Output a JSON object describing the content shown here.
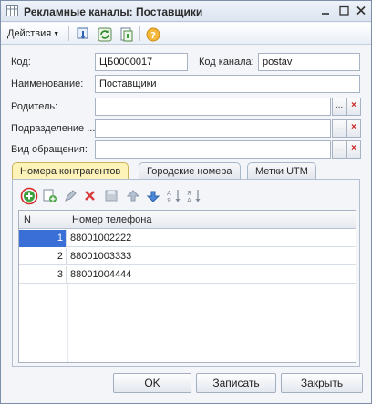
{
  "window": {
    "title": "Рекламные каналы: Поставщики"
  },
  "toolbar": {
    "actions_label": "Действия",
    "icons": [
      "save-to-list-icon",
      "refresh-icon",
      "copy-icon",
      "help-icon"
    ]
  },
  "form": {
    "code_label": "Код:",
    "code_value": "ЦБ0000017",
    "channel_code_label": "Код канала:",
    "channel_code_value": "postav",
    "name_label": "Наименование:",
    "name_value": "Поставщики",
    "parent_label": "Родитель:",
    "parent_value": "",
    "department_label": "Подразделение ...",
    "department_value": "",
    "request_type_label": "Вид обращения:",
    "request_type_value": "",
    "ellipsis": "...",
    "clear": "×"
  },
  "tabs": [
    {
      "label": "Номера контрагентов",
      "active": true
    },
    {
      "label": "Городские номера",
      "active": false
    },
    {
      "label": "Метки UTM",
      "active": false
    }
  ],
  "table": {
    "columns": [
      "N",
      "Номер телефона"
    ],
    "rows": [
      {
        "n": "1",
        "phone": "88001002222",
        "selected": true
      },
      {
        "n": "2",
        "phone": "88001003333",
        "selected": false
      },
      {
        "n": "3",
        "phone": "88001004444",
        "selected": false
      }
    ]
  },
  "footer": {
    "ok_label": "OK",
    "save_label": "Записать",
    "close_label": "Закрыть"
  },
  "colors": {
    "accent_green": "#3aa23a",
    "highlight_ring": "#d62b2b",
    "selection_blue": "#3a6fd8",
    "active_tab": "#fdf3b8"
  }
}
